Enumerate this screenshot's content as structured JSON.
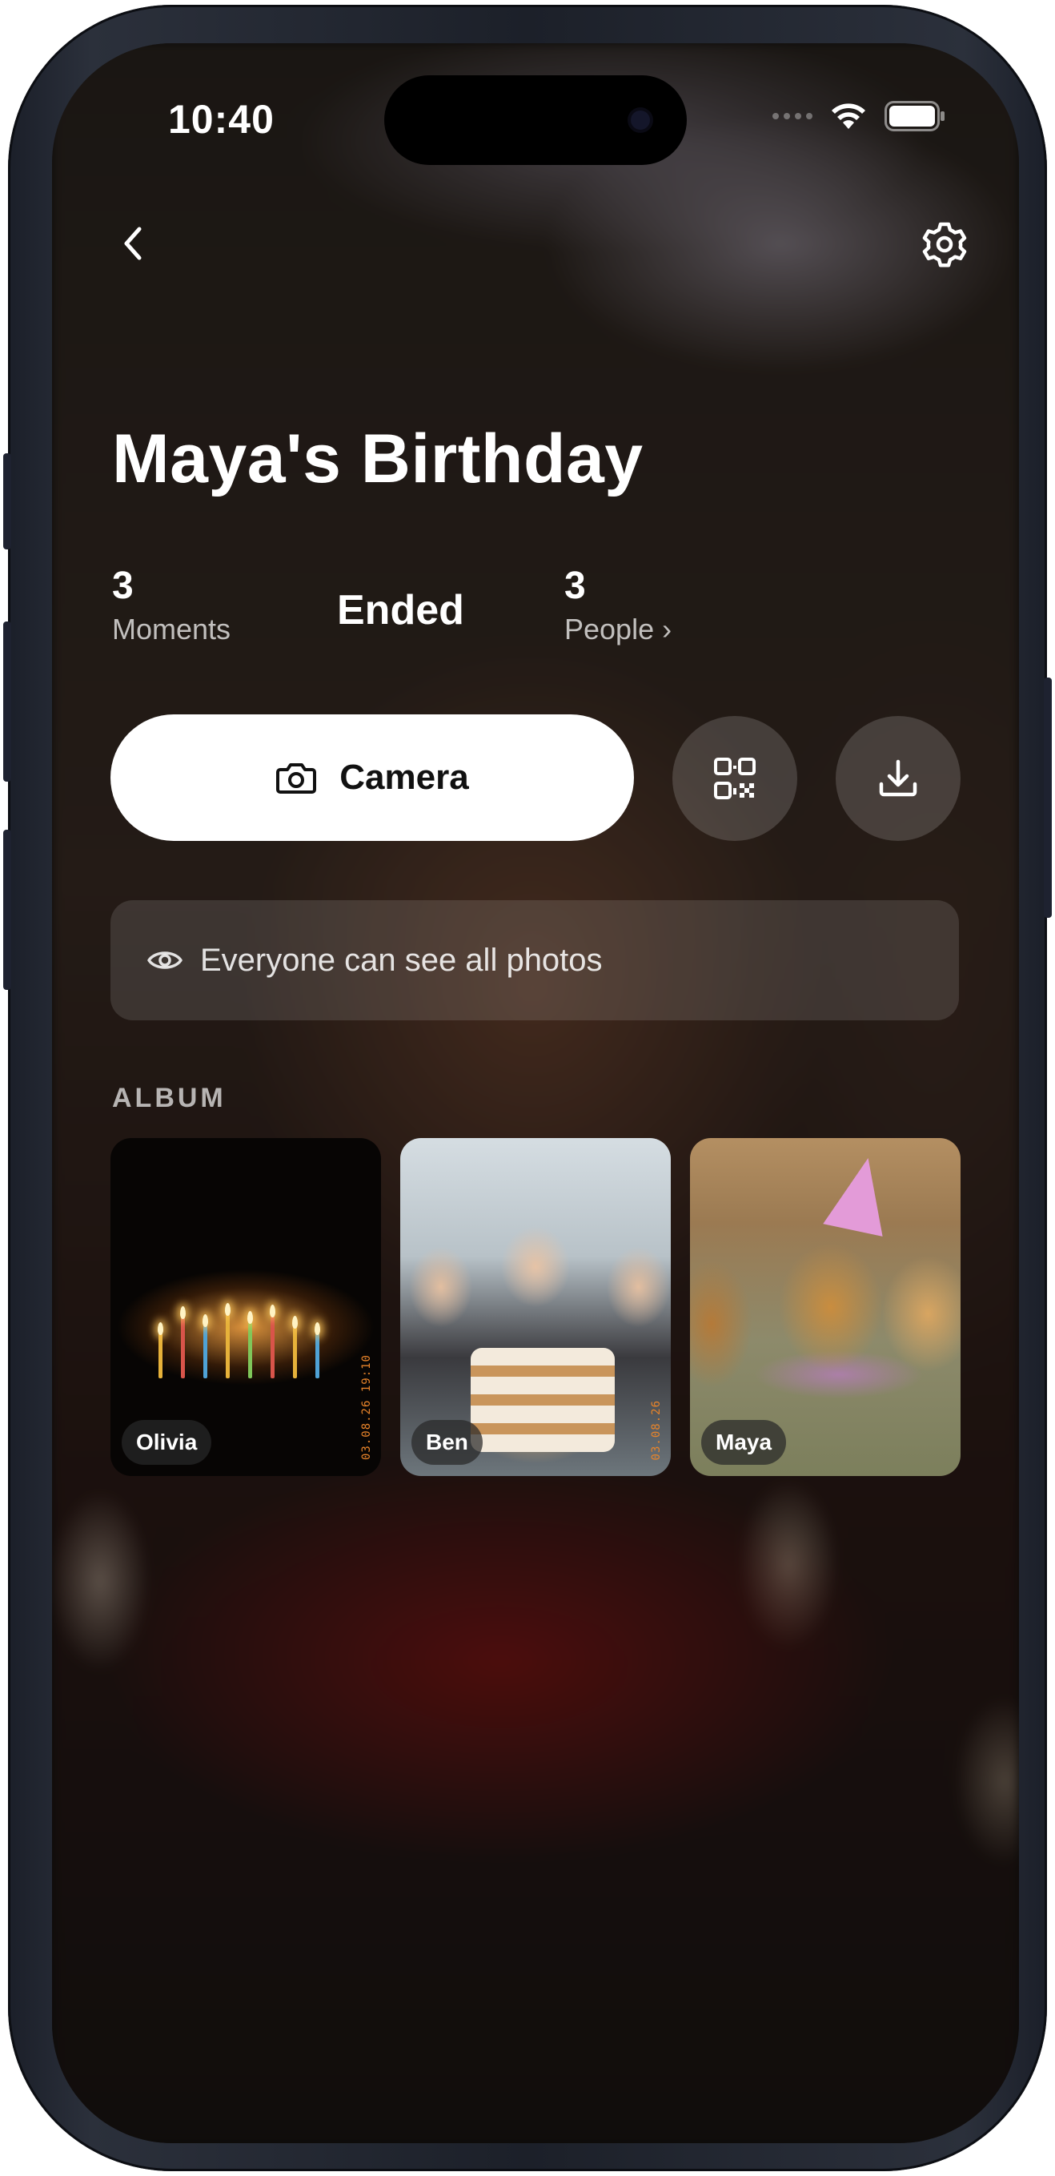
{
  "status_bar": {
    "time": "10:40"
  },
  "header": {
    "back_icon": "chevron-left-icon",
    "settings_icon": "gear-icon"
  },
  "event": {
    "title": "Maya's Birthday",
    "moments_count": "3",
    "moments_label": "Moments",
    "status": "Ended",
    "people_count": "3",
    "people_label": "People ›"
  },
  "actions": {
    "camera_label": "Camera",
    "camera_icon": "camera-icon",
    "qr_icon": "qr-code-icon",
    "download_icon": "download-icon"
  },
  "visibility": {
    "icon": "eye-icon",
    "text": "Everyone can see all photos"
  },
  "album": {
    "label": "ALBUM",
    "items": [
      {
        "name": "Olivia",
        "stamp": "03.08.26 19:10"
      },
      {
        "name": "Ben",
        "stamp": "03.08.26"
      },
      {
        "name": "Maya",
        "stamp": ""
      }
    ]
  },
  "colors": {
    "primary_button": "#ffffff",
    "text_primary": "#ffffff",
    "stamp": "#e8842a"
  }
}
